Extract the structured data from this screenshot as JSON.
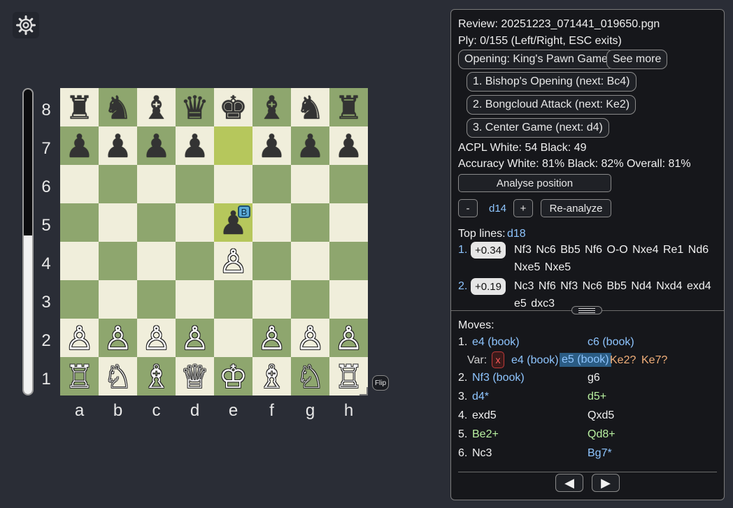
{
  "board": {
    "ranks": [
      "8",
      "7",
      "6",
      "5",
      "4",
      "3",
      "2",
      "1"
    ],
    "files": [
      "a",
      "b",
      "c",
      "d",
      "e",
      "f",
      "g",
      "h"
    ],
    "eval_white_fraction": 0.52,
    "squares": [
      [
        "♜",
        "♞",
        "♝",
        "♛",
        "♚",
        "♝",
        "♞",
        "♜"
      ],
      [
        "♟",
        "♟",
        "♟",
        "♟",
        "",
        "♟",
        "♟",
        "♟"
      ],
      [
        "",
        "",
        "",
        "",
        "",
        "",
        "",
        ""
      ],
      [
        "",
        "",
        "",
        "",
        "♟",
        "",
        "",
        ""
      ],
      [
        "",
        "",
        "",
        "",
        "♙",
        "",
        "",
        ""
      ],
      [
        "",
        "",
        "",
        "",
        "",
        "",
        "",
        ""
      ],
      [
        "♙",
        "♙",
        "♙",
        "♙",
        "",
        "♙",
        "♙",
        "♙"
      ],
      [
        "♖",
        "♘",
        "♗",
        "♕",
        "♔",
        "♗",
        "♘",
        "♖"
      ]
    ],
    "book_badge": "B",
    "flip_label": "Flip"
  },
  "panel": {
    "review_title": "Review: 20251223_071441_019650.pgn",
    "ply_line": "Ply: 0/155 (Left/Right, ESC exits)",
    "opening_label": "Opening: King's Pawn Game",
    "see_more": "See more",
    "suggestions": [
      "1. Bishop's Opening  (next: Bc4)",
      "2. Bongcloud Attack  (next: Ke2)",
      "3. Center Game  (next: d4)"
    ],
    "acpl": "ACPL  White: 54  Black: 49",
    "accuracy": "Accuracy  White: 81%  Black: 82%  Overall: 81%",
    "analyse_label": "Analyse position",
    "depth_minus": "-",
    "depth_value": "d14",
    "depth_plus": "+",
    "reanalyze_label": "Re-analyze",
    "top_lines_label": "Top lines:",
    "top_lines_depth": "d18",
    "lines": [
      {
        "num": "1.",
        "score": "+0.34",
        "moves_a": "Nf3  Nc6  Bb5  Nf6  O-O  Nxe4  Re1  Nd6",
        "moves_b": "Nxe5  Nxe5"
      },
      {
        "num": "2.",
        "score": "+0.19",
        "moves_a": "Nc3  Nf6  Nf3  Nc6  Bb5  Nd4  Nxd4  exd4",
        "moves_b": "e5  dxc3"
      }
    ],
    "moves_label": "Moves:",
    "var_label": "Var:",
    "var_x": "x",
    "var_moves": [
      "e4 (book)",
      "e5 (book)",
      "Ke2?",
      "Ke7?"
    ],
    "moves": [
      {
        "num": "1.",
        "white": "e4 (book)",
        "black": "c6 (book)"
      },
      {
        "num": "2.",
        "white": "Nf3 (book)",
        "black": "g6"
      },
      {
        "num": "3.",
        "white": "d4*",
        "black": "d5+"
      },
      {
        "num": "4.",
        "white": "exd5",
        "black": "Qxd5"
      },
      {
        "num": "5.",
        "white": "Be2+",
        "black": "Qd8+"
      },
      {
        "num": "6.",
        "white": "Nc3",
        "black": "Bg7*"
      }
    ],
    "prev_label": "◀",
    "next_label": "▶"
  }
}
